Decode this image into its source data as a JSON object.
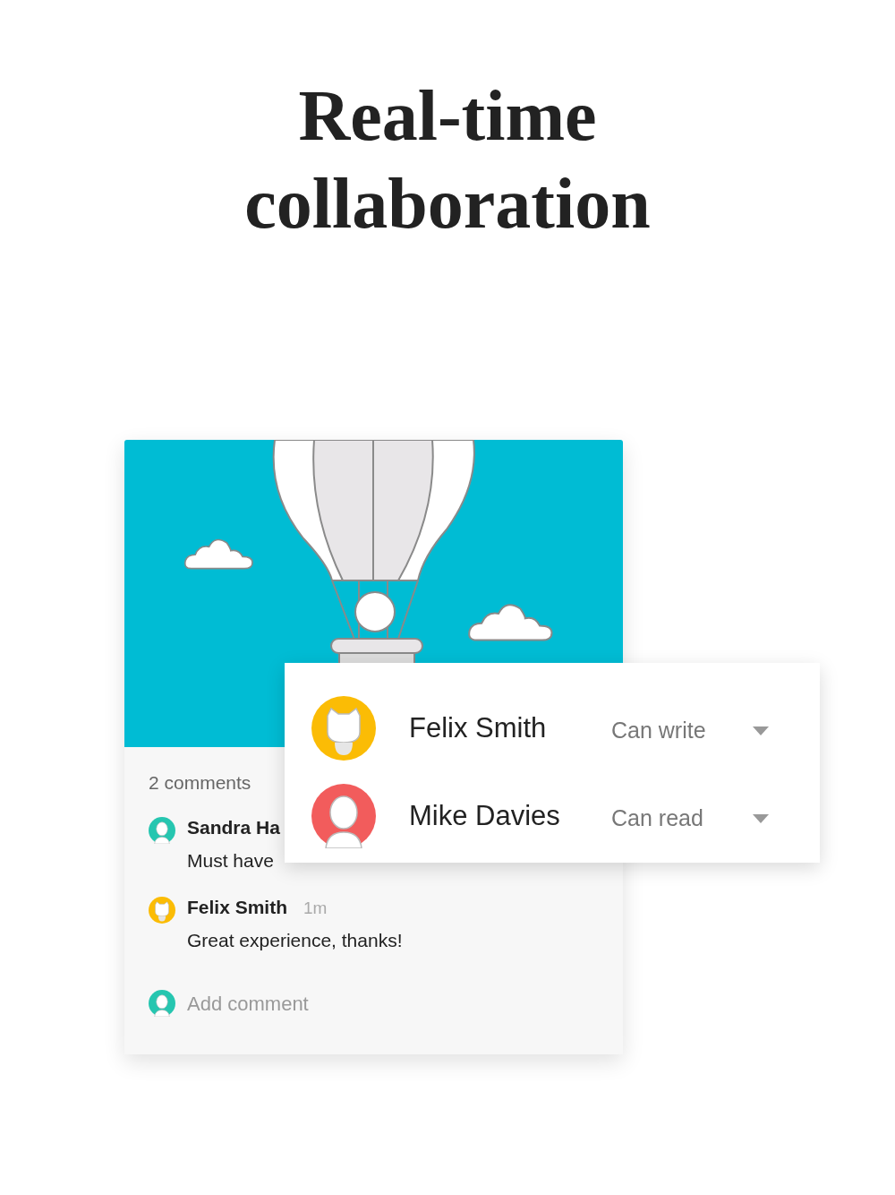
{
  "heading": "Real-time collaboration",
  "card": {
    "comments_count": "2 comments",
    "comments": [
      {
        "author": "Sandra Ha",
        "text": "Must have",
        "kind": "person",
        "color": "#26c6b0"
      },
      {
        "author": "Felix Smith",
        "time": "1m",
        "text": "Great experience, thanks!",
        "kind": "cat",
        "color": "#fbbc05"
      }
    ],
    "add_comment": {
      "placeholder": "Add comment",
      "kind": "person",
      "color": "#26c6b0"
    }
  },
  "share_popup": {
    "members": [
      {
        "name": "Felix Smith",
        "permission": "Can write",
        "kind": "cat",
        "color": "#fbbc05"
      },
      {
        "name": "Mike Davies",
        "permission": "Can read",
        "kind": "person",
        "color": "#f25c5c"
      }
    ]
  }
}
